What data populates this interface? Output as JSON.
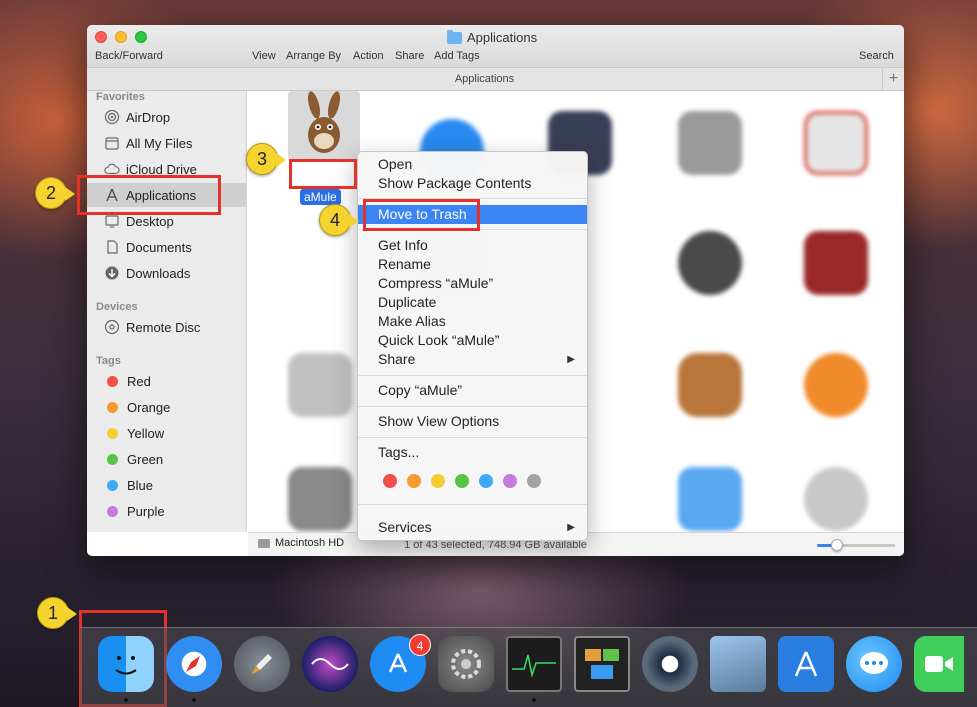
{
  "window": {
    "title": "Applications",
    "toolbar": {
      "back_forward": "Back/Forward",
      "view": "View",
      "arrange_by": "Arrange By",
      "action": "Action",
      "share": "Share",
      "add_tags": "Add Tags",
      "search": "Search"
    },
    "path_title": "Applications",
    "plus": "+"
  },
  "sidebar": {
    "favorites_header": "Favorites",
    "favorites": [
      {
        "label": "AirDrop",
        "icon": "airdrop-icon"
      },
      {
        "label": "All My Files",
        "icon": "all-files-icon"
      },
      {
        "label": "iCloud Drive",
        "icon": "cloud-icon"
      },
      {
        "label": "Applications",
        "icon": "applications-icon",
        "selected": true
      },
      {
        "label": "Desktop",
        "icon": "desktop-icon"
      },
      {
        "label": "Documents",
        "icon": "documents-icon"
      },
      {
        "label": "Downloads",
        "icon": "downloads-icon"
      }
    ],
    "devices_header": "Devices",
    "devices": [
      {
        "label": "Remote Disc",
        "icon": "disc-icon"
      }
    ],
    "tags_header": "Tags",
    "tags": [
      {
        "label": "Red",
        "color": "#f0504a"
      },
      {
        "label": "Orange",
        "color": "#f59a30"
      },
      {
        "label": "Yellow",
        "color": "#f5cd32"
      },
      {
        "label": "Green",
        "color": "#58c447"
      },
      {
        "label": "Blue",
        "color": "#3ea9f5"
      },
      {
        "label": "Purple",
        "color": "#c67be0"
      }
    ]
  },
  "content": {
    "selected_app": "aMule",
    "path_item": "Macintosh HD",
    "status": "1 of 43 selected, 748.94 GB available",
    "zoom_level": 0.25
  },
  "context_menu": {
    "open": "Open",
    "show_package": "Show Package Contents",
    "move_to_trash": "Move to Trash",
    "get_info": "Get Info",
    "rename": "Rename",
    "compress": "Compress “aMule”",
    "duplicate": "Duplicate",
    "make_alias": "Make Alias",
    "quick_look": "Quick Look “aMule”",
    "share": "Share",
    "copy": "Copy “aMule”",
    "show_view_options": "Show View Options",
    "tags": "Tags...",
    "services": "Services",
    "submenu_arrow": "▶",
    "tag_colors": [
      "#f0504a",
      "#f59a30",
      "#f5cd32",
      "#58c447",
      "#3ea9f5",
      "#c67be0",
      "#a3a3a3"
    ]
  },
  "callouts": {
    "step1": "1",
    "step2": "2",
    "step3": "3",
    "step4": "4"
  },
  "dock": {
    "app_store_badge": "4",
    "apps": [
      "finder-icon",
      "safari-icon",
      "launchpad-icon",
      "siri-icon",
      "app-store-icon",
      "system-preferences-icon",
      "activity-monitor-icon",
      "mission-control-icon",
      "quicktime-icon",
      "preview-icon",
      "xcode-icon",
      "messages-icon",
      "facetime-icon"
    ]
  }
}
